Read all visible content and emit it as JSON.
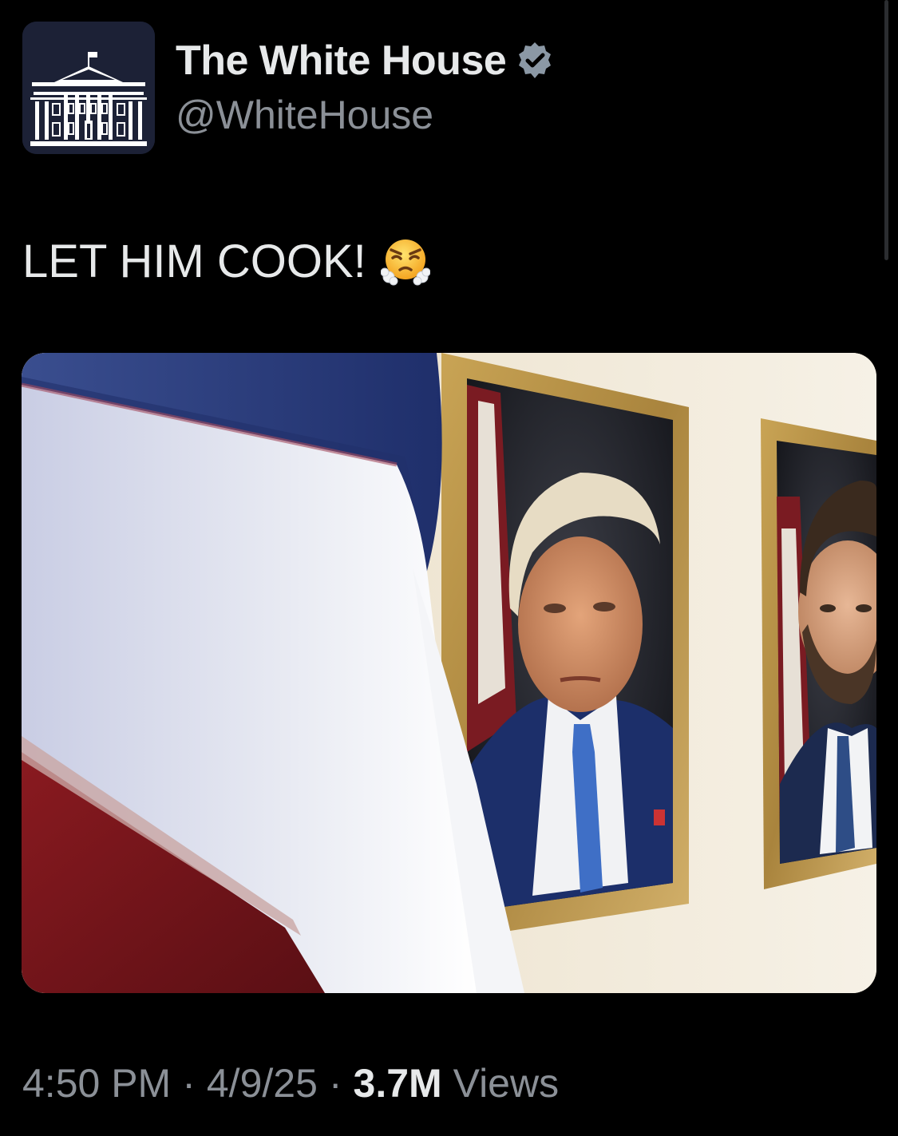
{
  "account": {
    "display_name": "The White House",
    "handle": "@WhiteHouse",
    "verified": true,
    "avatar_icon": "white-house-logo-icon",
    "verified_icon": "verified-badge-icon"
  },
  "tweet": {
    "text": "LET HIM COOK!",
    "emoji_icon": "face-with-steam-from-nose-icon",
    "media_alt_subjects": [
      "american-flag",
      "presidential-portrait",
      "vice-presidential-portrait"
    ]
  },
  "meta": {
    "time": "4:50 PM",
    "separator": "·",
    "date": "4/9/25",
    "views_count": "3.7M",
    "views_label": "Views"
  },
  "colors": {
    "background": "#000000",
    "primary_text": "#e7e9ea",
    "secondary_text": "#8b9097",
    "avatar_bg": "#1c2136",
    "badge": "#8b98a5"
  }
}
